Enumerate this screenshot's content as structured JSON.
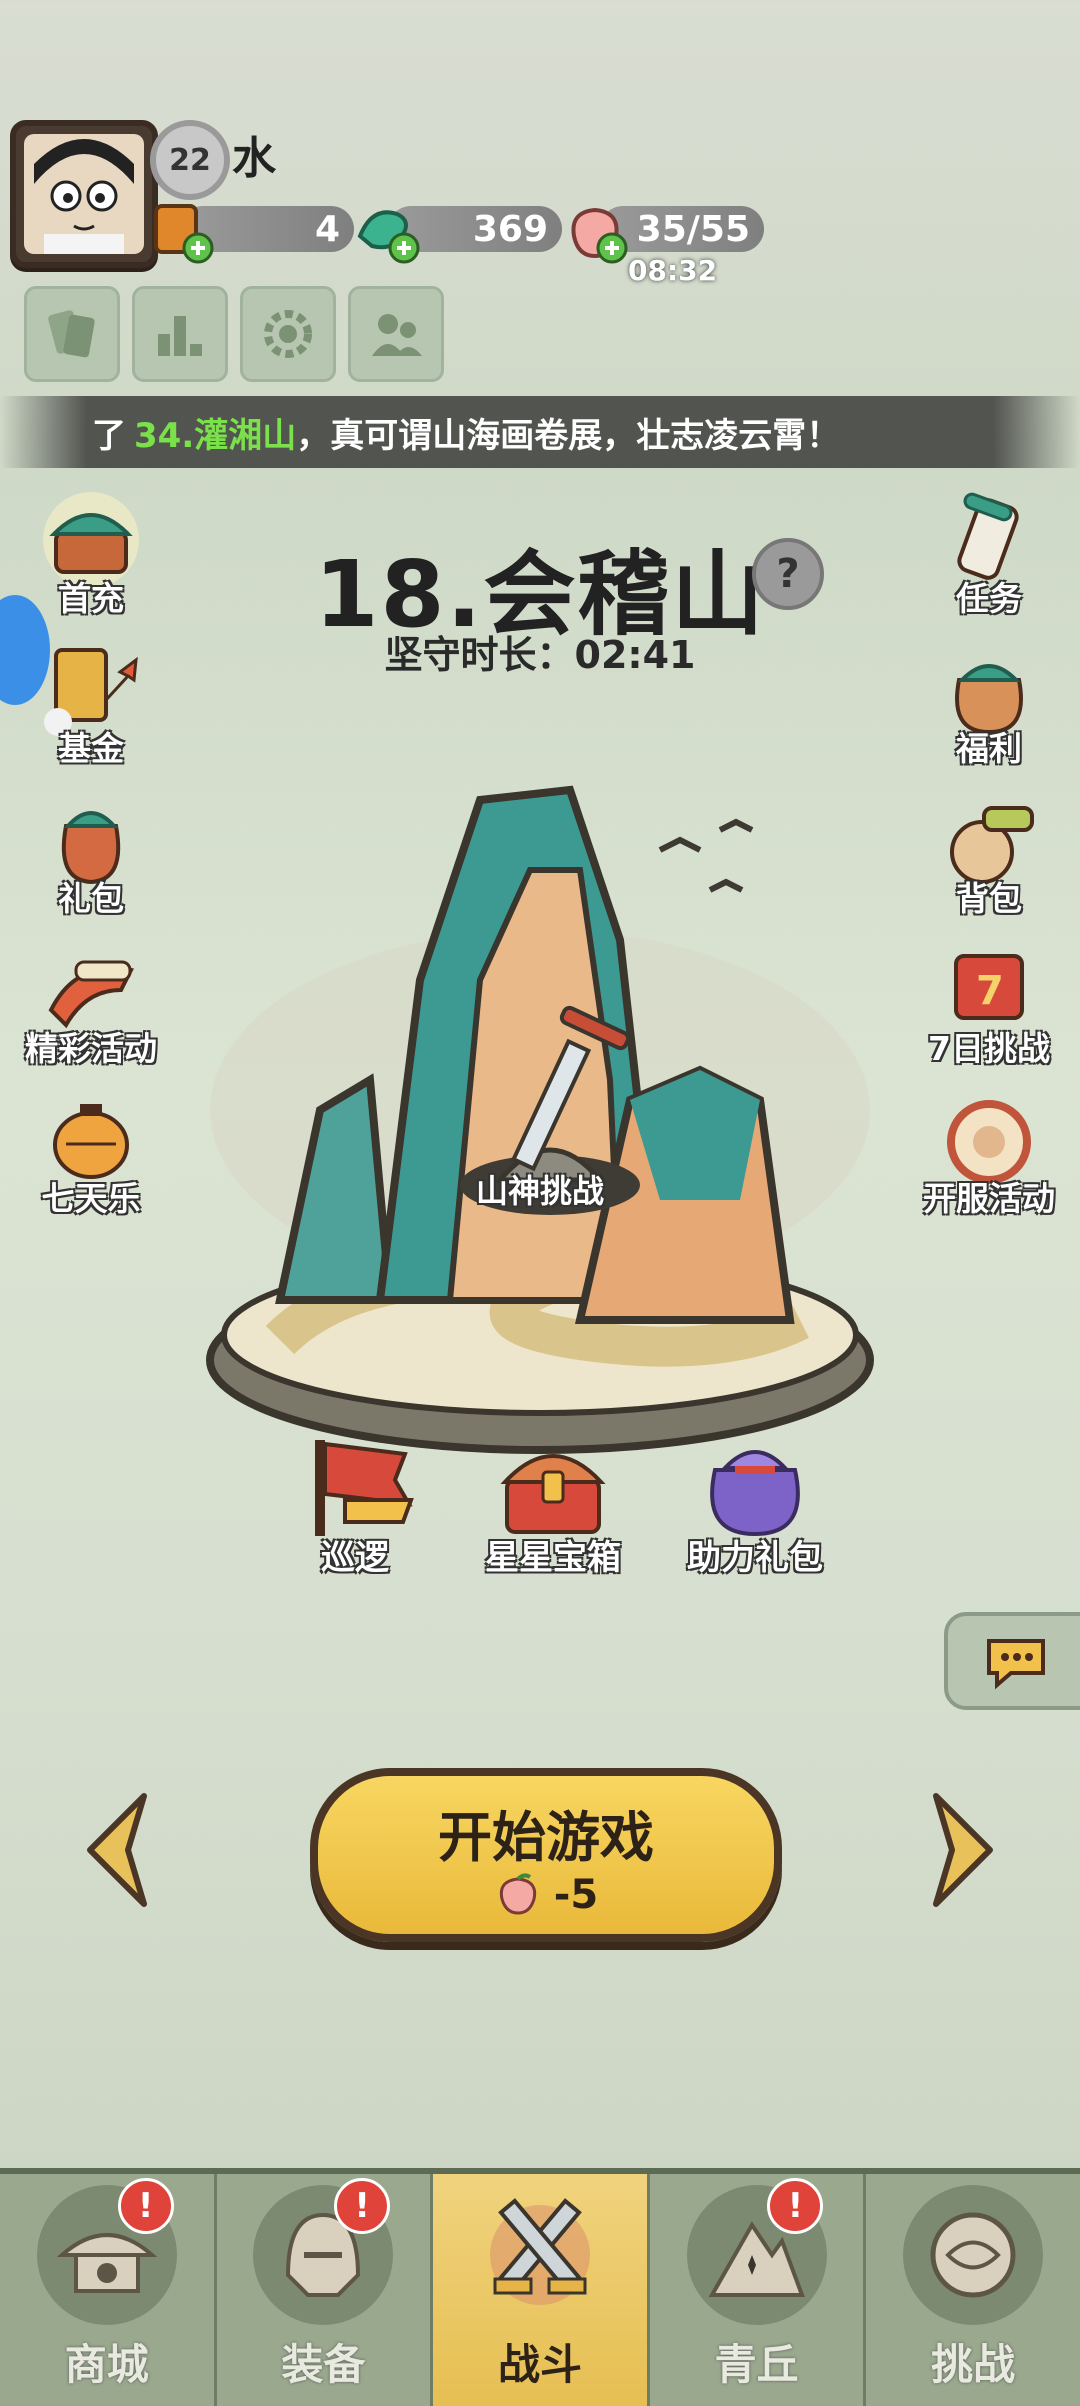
{
  "player": {
    "level": "22",
    "name": "水"
  },
  "resources": [
    {
      "icon": "scroll-ticket-icon",
      "value": "4"
    },
    {
      "icon": "jade-dragon-icon",
      "value": "369"
    },
    {
      "icon": "peach-stamina-icon",
      "value": "35/55"
    }
  ],
  "stamina_timer": "08:32",
  "banner": {
    "prefix": "了",
    "highlight": "34.灌湘山",
    "suffix": "，真可谓山海画卷展，壮志凌云霄！"
  },
  "stage": {
    "title": "18.会稽山",
    "guard_label": "坚守时长：02:41"
  },
  "left_menu": [
    {
      "name": "first-recharge",
      "label": "首充"
    },
    {
      "name": "fund",
      "label": "基金"
    },
    {
      "name": "gift-pack",
      "label": "礼包"
    },
    {
      "name": "events",
      "label": "精彩活动"
    },
    {
      "name": "seven-day-joy",
      "label": "七天乐"
    }
  ],
  "right_menu": [
    {
      "name": "tasks",
      "label": "任务"
    },
    {
      "name": "welfare",
      "label": "福利"
    },
    {
      "name": "backpack",
      "label": "背包"
    },
    {
      "name": "seven-day-challenge",
      "label": "7日挑战"
    },
    {
      "name": "server-event",
      "label": "开服活动"
    }
  ],
  "scene": {
    "challenge_label": "山神挑战"
  },
  "rewards": [
    {
      "name": "patrol",
      "label": "巡逻"
    },
    {
      "name": "star-chest",
      "label": "星星宝箱"
    },
    {
      "name": "assist-gift",
      "label": "助力礼包"
    }
  ],
  "start": {
    "label": "开始游戏",
    "cost": "-5"
  },
  "nav": [
    {
      "name": "shop",
      "label": "商城",
      "alert": "!"
    },
    {
      "name": "equipment",
      "label": "装备",
      "alert": "!"
    },
    {
      "name": "battle",
      "label": "战斗",
      "alert": ""
    },
    {
      "name": "qingqiu",
      "label": "青丘",
      "alert": "!"
    },
    {
      "name": "challenge",
      "label": "挑战",
      "alert": ""
    }
  ],
  "colors": {
    "accent_gold": "#e9b93a",
    "highlight_green": "#7be14b",
    "alert_red": "#e0433a"
  }
}
